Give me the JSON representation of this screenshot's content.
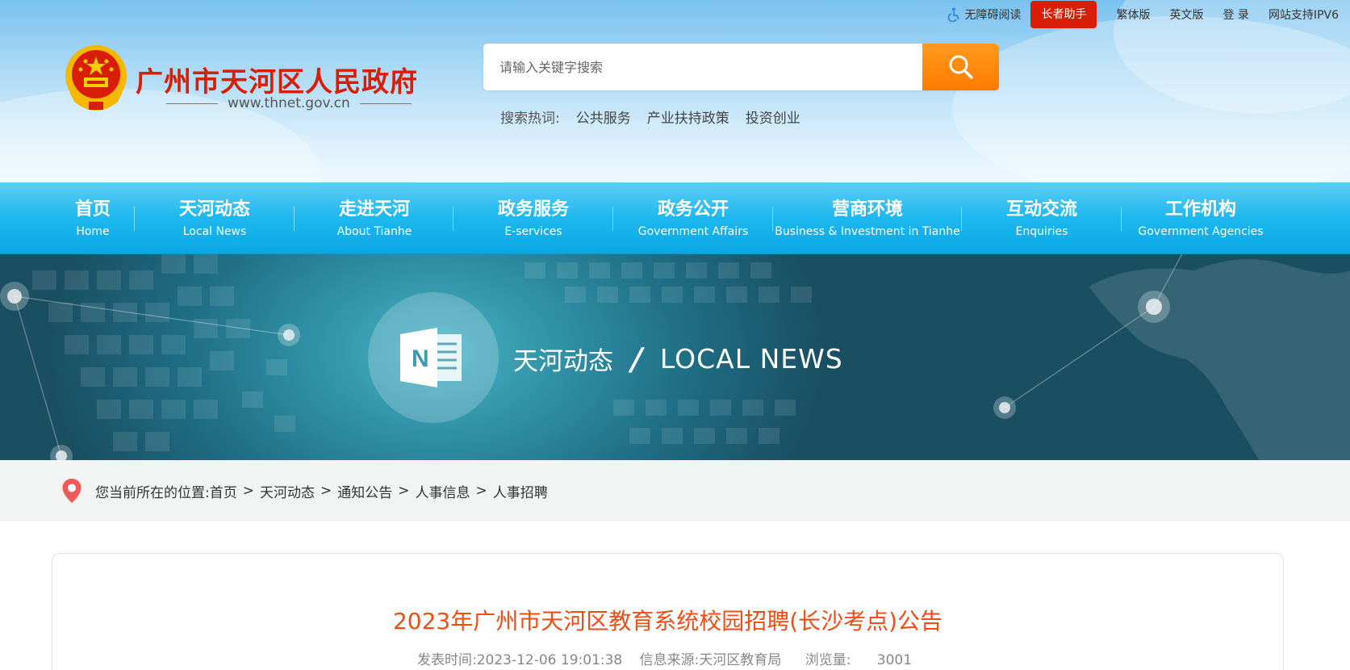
{
  "topbar": {
    "accessibility_label": "无障碍阅读",
    "elder_label": "长者助手",
    "traditional_label": "繁体版",
    "english_label": "英文版",
    "login_label": "登 录",
    "ipv6_label": "网站支持IPV6"
  },
  "site": {
    "name": "广州市天河区人民政府",
    "url": "www.thnet.gov.cn"
  },
  "search": {
    "placeholder": "请输入关键字搜索",
    "hot_label": "搜索热词:",
    "hot_words": [
      "公共服务",
      "产业扶持政策",
      "投资创业"
    ]
  },
  "nav": {
    "items": [
      {
        "cn": "首页",
        "en": "Home"
      },
      {
        "cn": "天河动态",
        "en": "Local News"
      },
      {
        "cn": "走进天河",
        "en": "About Tianhe"
      },
      {
        "cn": "政务服务",
        "en": "E-services"
      },
      {
        "cn": "政务公开",
        "en": "Government Affairs"
      },
      {
        "cn": "营商环境",
        "en": "Business & Investment in Tianhe"
      },
      {
        "cn": "互动交流",
        "en": "Enquiries"
      },
      {
        "cn": "工作机构",
        "en": "Government Agencies"
      }
    ]
  },
  "banner": {
    "icon_letter": "N",
    "title_cn": "天河动态",
    "slash": "/",
    "title_en": "LOCAL NEWS"
  },
  "breadcrumb": {
    "prefix": "您当前所在的位置:",
    "separator": ">",
    "items": [
      "首页",
      "天河动态",
      "通知公告",
      "人事信息",
      "人事招聘"
    ]
  },
  "article": {
    "title": "2023年广州市天河区教育系统校园招聘(长沙考点)公告",
    "publish_time": "发表时间:2023-12-06 19:01:38",
    "source": "信息来源:天河区教育局",
    "views_label": "浏览量:",
    "views": "3001"
  },
  "colors": {
    "brand_red": "#d81e06",
    "nav_blue": "#1db8ef",
    "search_orange": "#ff8a00",
    "title_orange": "#ef4d14"
  }
}
